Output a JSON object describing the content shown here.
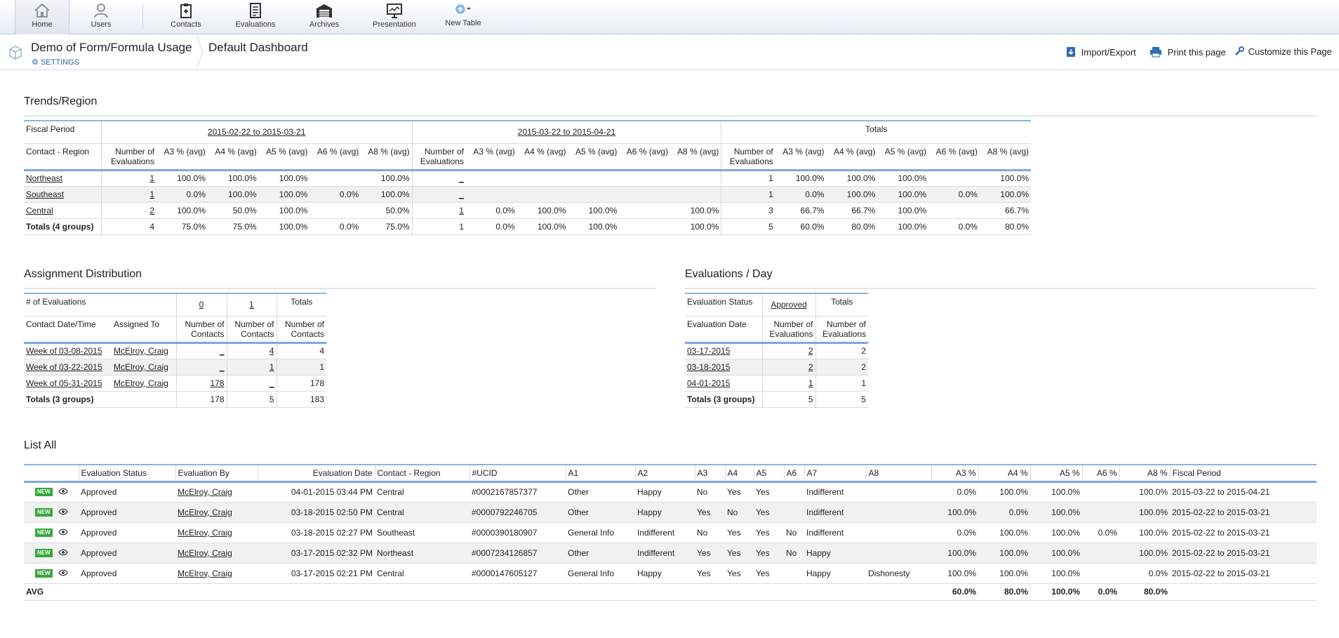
{
  "nav": {
    "items": [
      {
        "label": "Home",
        "icon": "home-icon"
      },
      {
        "label": "Users",
        "icon": "user-icon"
      },
      {
        "label": "Contacts",
        "icon": "clipboard-icon"
      },
      {
        "label": "Evaluations",
        "icon": "checklist-icon"
      },
      {
        "label": "Archives",
        "icon": "archive-icon"
      },
      {
        "label": "Presentation",
        "icon": "presentation-icon"
      },
      {
        "label": "New Table",
        "icon": "add-table-icon"
      }
    ]
  },
  "header": {
    "title": "Demo of Form/Formula Usage",
    "settings": "SETTINGS",
    "dashboard": "Default Dashboard",
    "import_export": "Import/Export",
    "print": "Print this page",
    "customize": "Customize this Page"
  },
  "trends": {
    "title": "Trends/Region",
    "fiscal_label": "Fiscal Period",
    "period1": "2015-02-22 to 2015-03-21",
    "period2": "2015-03-22 to 2015-04-21",
    "totals": "Totals",
    "region_label": "Contact - Region",
    "cols": [
      "Number of Evaluations",
      "A3 % (avg)",
      "A4 % (avg)",
      "A5 % (avg)",
      "A6 % (avg)",
      "A8 % (avg)"
    ],
    "rows": [
      {
        "name": "Northeast",
        "p1": [
          "1",
          "100.0%",
          "100.0%",
          "100.0%",
          "",
          "100.0%"
        ],
        "p2": [
          "_",
          "",
          "",
          "",
          "",
          ""
        ],
        "tot": [
          "1",
          "100.0%",
          "100.0%",
          "100.0%",
          "",
          "100.0%"
        ]
      },
      {
        "name": "Southeast",
        "p1": [
          "1",
          "0.0%",
          "100.0%",
          "100.0%",
          "0.0%",
          "100.0%"
        ],
        "p2": [
          "_",
          "",
          "",
          "",
          "",
          ""
        ],
        "tot": [
          "1",
          "0.0%",
          "100.0%",
          "100.0%",
          "0.0%",
          "100.0%"
        ]
      },
      {
        "name": "Central",
        "p1": [
          "2",
          "100.0%",
          "50.0%",
          "100.0%",
          "",
          "50.0%"
        ],
        "p2": [
          "1",
          "0.0%",
          "100.0%",
          "100.0%",
          "",
          "100.0%"
        ],
        "tot": [
          "3",
          "66.7%",
          "66.7%",
          "100.0%",
          "",
          "66.7%"
        ]
      }
    ],
    "total_row": {
      "name": "Totals (4 groups)",
      "p1": [
        "4",
        "75.0%",
        "75.0%",
        "100.0%",
        "0.0%",
        "75.0%"
      ],
      "p2": [
        "1",
        "0.0%",
        "100.0%",
        "100.0%",
        "",
        "100.0%"
      ],
      "tot": [
        "5",
        "60.0%",
        "80.0%",
        "100.0%",
        "0.0%",
        "80.0%"
      ]
    }
  },
  "assign": {
    "title": "Assignment Distribution",
    "evals_label": "# of Evaluations",
    "c0": "0",
    "c1": "1",
    "totals": "Totals",
    "col_date": "Contact Date/Time",
    "col_assigned": "Assigned To",
    "col_num": "Number of Contacts",
    "rows": [
      {
        "date": "Week of 03-08-2015",
        "who": "McElroy, Craig",
        "v0": "_",
        "v1": "4",
        "tot": "4"
      },
      {
        "date": "Week of 03-22-2015",
        "who": "McElroy, Craig",
        "v0": "_",
        "v1": "1",
        "tot": "1"
      },
      {
        "date": "Week of 05-31-2015",
        "who": "McElroy, Craig",
        "v0": "178",
        "v1": "_",
        "tot": "178"
      }
    ],
    "total_row": {
      "label": "Totals (3 groups)",
      "v0": "178",
      "v1": "5",
      "tot": "183"
    }
  },
  "perday": {
    "title": "Evaluations / Day",
    "status_label": "Evaluation Status",
    "approved": "Approved",
    "totals": "Totals",
    "date_label": "Evaluation Date",
    "col_num": "Number of Evaluations",
    "rows": [
      {
        "date": "03-17-2015",
        "v": "2",
        "tot": "2"
      },
      {
        "date": "03-18-2015",
        "v": "2",
        "tot": "2"
      },
      {
        "date": "04-01-2015",
        "v": "1",
        "tot": "1"
      }
    ],
    "total_row": {
      "label": "Totals (3 groups)",
      "v": "5",
      "tot": "5"
    }
  },
  "listall": {
    "title": "List All",
    "badge": "NEW",
    "headers": [
      "Evaluation Status",
      "Evaluation By",
      "Evaluation Date",
      "Contact - Region",
      "#UCID",
      "A1",
      "A2",
      "A3",
      "A4",
      "A5",
      "A6",
      "A7",
      "A8",
      "A3 %",
      "A4 %",
      "A5 %",
      "A6 %",
      "A8 %",
      "Fiscal Period"
    ],
    "rows": [
      [
        "Approved",
        "McElroy, Craig",
        "04-01-2015 03:44 PM",
        "Central",
        "#0002167857377",
        "Other",
        "Happy",
        "No",
        "Yes",
        "Yes",
        "",
        "Indifferent",
        "",
        "0.0%",
        "100.0%",
        "100.0%",
        "",
        "100.0%",
        "2015-03-22 to 2015-04-21"
      ],
      [
        "Approved",
        "McElroy, Craig",
        "03-18-2015 02:50 PM",
        "Central",
        "#0000792246705",
        "Other",
        "Happy",
        "Yes",
        "No",
        "Yes",
        "",
        "Indifferent",
        "",
        "100.0%",
        "0.0%",
        "100.0%",
        "",
        "100.0%",
        "2015-02-22 to 2015-03-21"
      ],
      [
        "Approved",
        "McElroy, Craig",
        "03-18-2015 02:27 PM",
        "Southeast",
        "#0000390180907",
        "General Info",
        "Indifferent",
        "No",
        "Yes",
        "Yes",
        "No",
        "Indifferent",
        "",
        "0.0%",
        "100.0%",
        "100.0%",
        "0.0%",
        "100.0%",
        "2015-02-22 to 2015-03-21"
      ],
      [
        "Approved",
        "McElroy, Craig",
        "03-17-2015 02:32 PM",
        "Northeast",
        "#0007234126857",
        "Other",
        "Indifferent",
        "Yes",
        "Yes",
        "Yes",
        "No",
        "Happy",
        "",
        "100.0%",
        "100.0%",
        "100.0%",
        "",
        "100.0%",
        "2015-02-22 to 2015-03-21"
      ],
      [
        "Approved",
        "McElroy, Craig",
        "03-17-2015 02:21 PM",
        "Central",
        "#0000147605127",
        "General Info",
        "Happy",
        "Yes",
        "Yes",
        "Yes",
        "",
        "Happy",
        "Dishonesty",
        "100.0%",
        "100.0%",
        "100.0%",
        "",
        "0.0%",
        "2015-02-22 to 2015-03-21"
      ]
    ],
    "avg_label": "AVG",
    "avg": [
      "60.0%",
      "80.0%",
      "100.0%",
      "0.0%",
      "80.0%"
    ]
  }
}
